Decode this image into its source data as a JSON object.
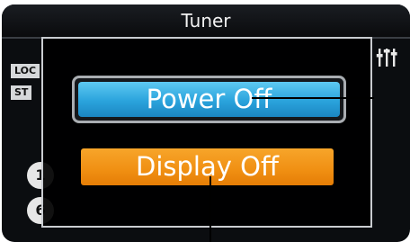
{
  "header": {
    "title": "Tuner"
  },
  "side_tags": [
    "LOC",
    "ST"
  ],
  "presets": [
    "1",
    "6"
  ],
  "popup": {
    "power_off_label": "Power Off",
    "display_off_label": "Display Off"
  },
  "icons": {
    "settings": "equalizer-sliders-icon"
  },
  "colors": {
    "power_button": "#2aa3dc",
    "display_button": "#f08f12",
    "screen_background": "#0b0d10"
  }
}
